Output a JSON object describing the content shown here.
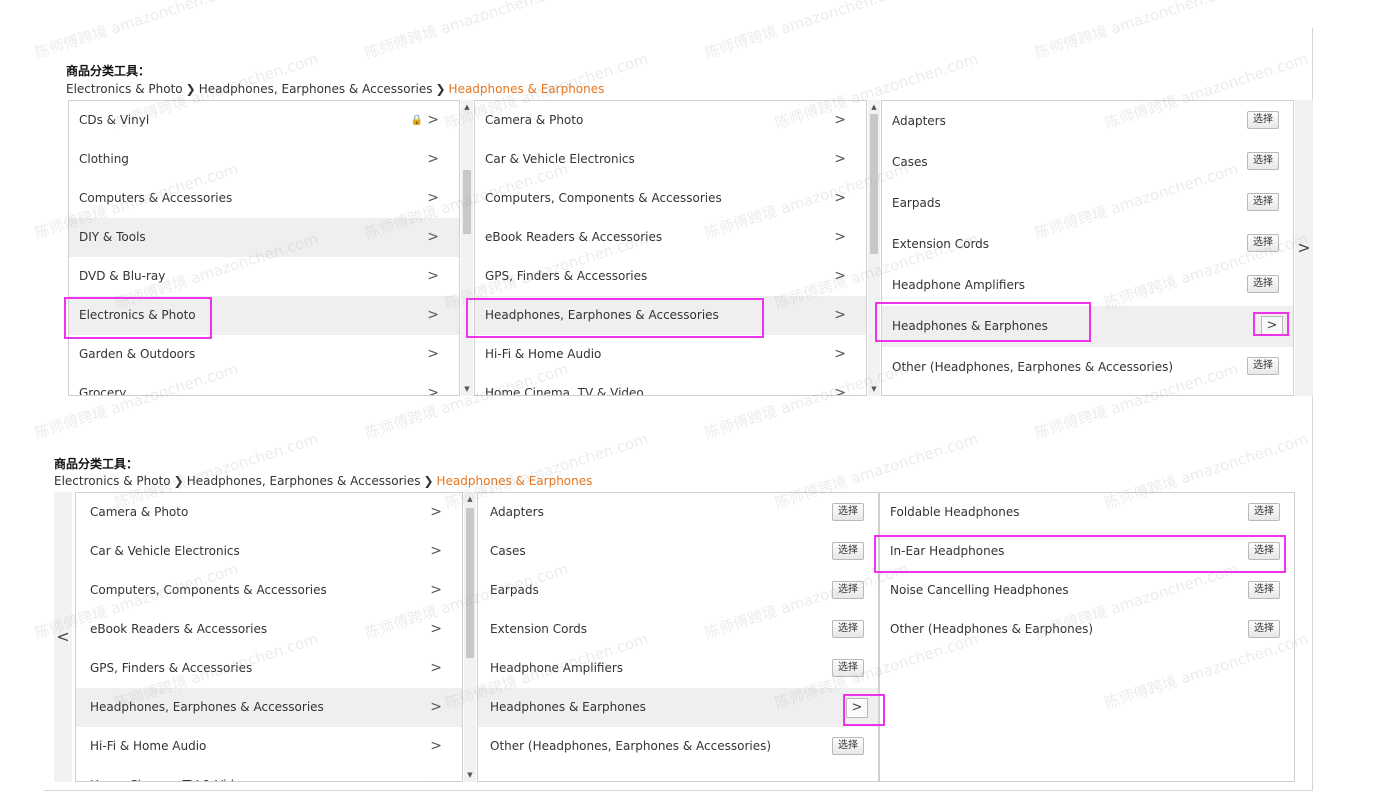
{
  "panel1": {
    "title": "商品分类工具：",
    "crumbs": [
      "Electronics & Photo",
      "Headphones, Earphones & Accessories"
    ],
    "crumb_current": "Headphones & Earphones",
    "col1": [
      {
        "label": "CDs & Vinyl"
      },
      {
        "label": "Clothing"
      },
      {
        "label": "Computers & Accessories"
      },
      {
        "label": "DIY & Tools"
      },
      {
        "label": "DVD & Blu-ray"
      },
      {
        "label": "Electronics & Photo"
      },
      {
        "label": "Garden & Outdoors"
      },
      {
        "label": "Grocery"
      }
    ],
    "col2": [
      {
        "label": "Camera & Photo"
      },
      {
        "label": "Car & Vehicle Electronics"
      },
      {
        "label": "Computers, Components & Accessories"
      },
      {
        "label": "eBook Readers & Accessories"
      },
      {
        "label": "GPS, Finders & Accessories"
      },
      {
        "label": "Headphones, Earphones & Accessories"
      },
      {
        "label": "Hi-Fi & Home Audio"
      },
      {
        "label": "Home Cinema, TV & Video"
      }
    ],
    "col3": [
      {
        "label": "Adapters"
      },
      {
        "label": "Cases"
      },
      {
        "label": "Earpads"
      },
      {
        "label": "Extension Cords"
      },
      {
        "label": "Headphone Amplifiers"
      },
      {
        "label": "Headphones & Earphones"
      },
      {
        "label": "Other (Headphones, Earphones & Accessories)"
      }
    ]
  },
  "panel2": {
    "title": "商品分类工具：",
    "crumbs": [
      "Electronics & Photo",
      "Headphones, Earphones & Accessories"
    ],
    "crumb_current": "Headphones & Earphones",
    "col1": [
      {
        "label": "Camera & Photo"
      },
      {
        "label": "Car & Vehicle Electronics"
      },
      {
        "label": "Computers, Components & Accessories"
      },
      {
        "label": "eBook Readers & Accessories"
      },
      {
        "label": "GPS, Finders & Accessories"
      },
      {
        "label": "Headphones, Earphones & Accessories"
      },
      {
        "label": "Hi-Fi & Home Audio"
      },
      {
        "label": "Home Cinema, TV & Video"
      }
    ],
    "col2": [
      {
        "label": "Adapters"
      },
      {
        "label": "Cases"
      },
      {
        "label": "Earpads"
      },
      {
        "label": "Extension Cords"
      },
      {
        "label": "Headphone Amplifiers"
      },
      {
        "label": "Headphones & Earphones"
      },
      {
        "label": "Other (Headphones, Earphones & Accessories)"
      }
    ],
    "col3": [
      {
        "label": "Foldable Headphones"
      },
      {
        "label": "In-Ear Headphones"
      },
      {
        "label": "Noise Cancelling Headphones"
      },
      {
        "label": "Other (Headphones & Earphones)"
      }
    ]
  },
  "select_label": "选择",
  "chevron": ">",
  "prev_chevron": "<",
  "watermark": {
    "brand": "amazonchen.com",
    "cn": "陈师傅跨境"
  },
  "colors": {
    "highlight": "#ee33ee",
    "current_crumb": "#e8741c",
    "selected_row": "#efefef"
  }
}
